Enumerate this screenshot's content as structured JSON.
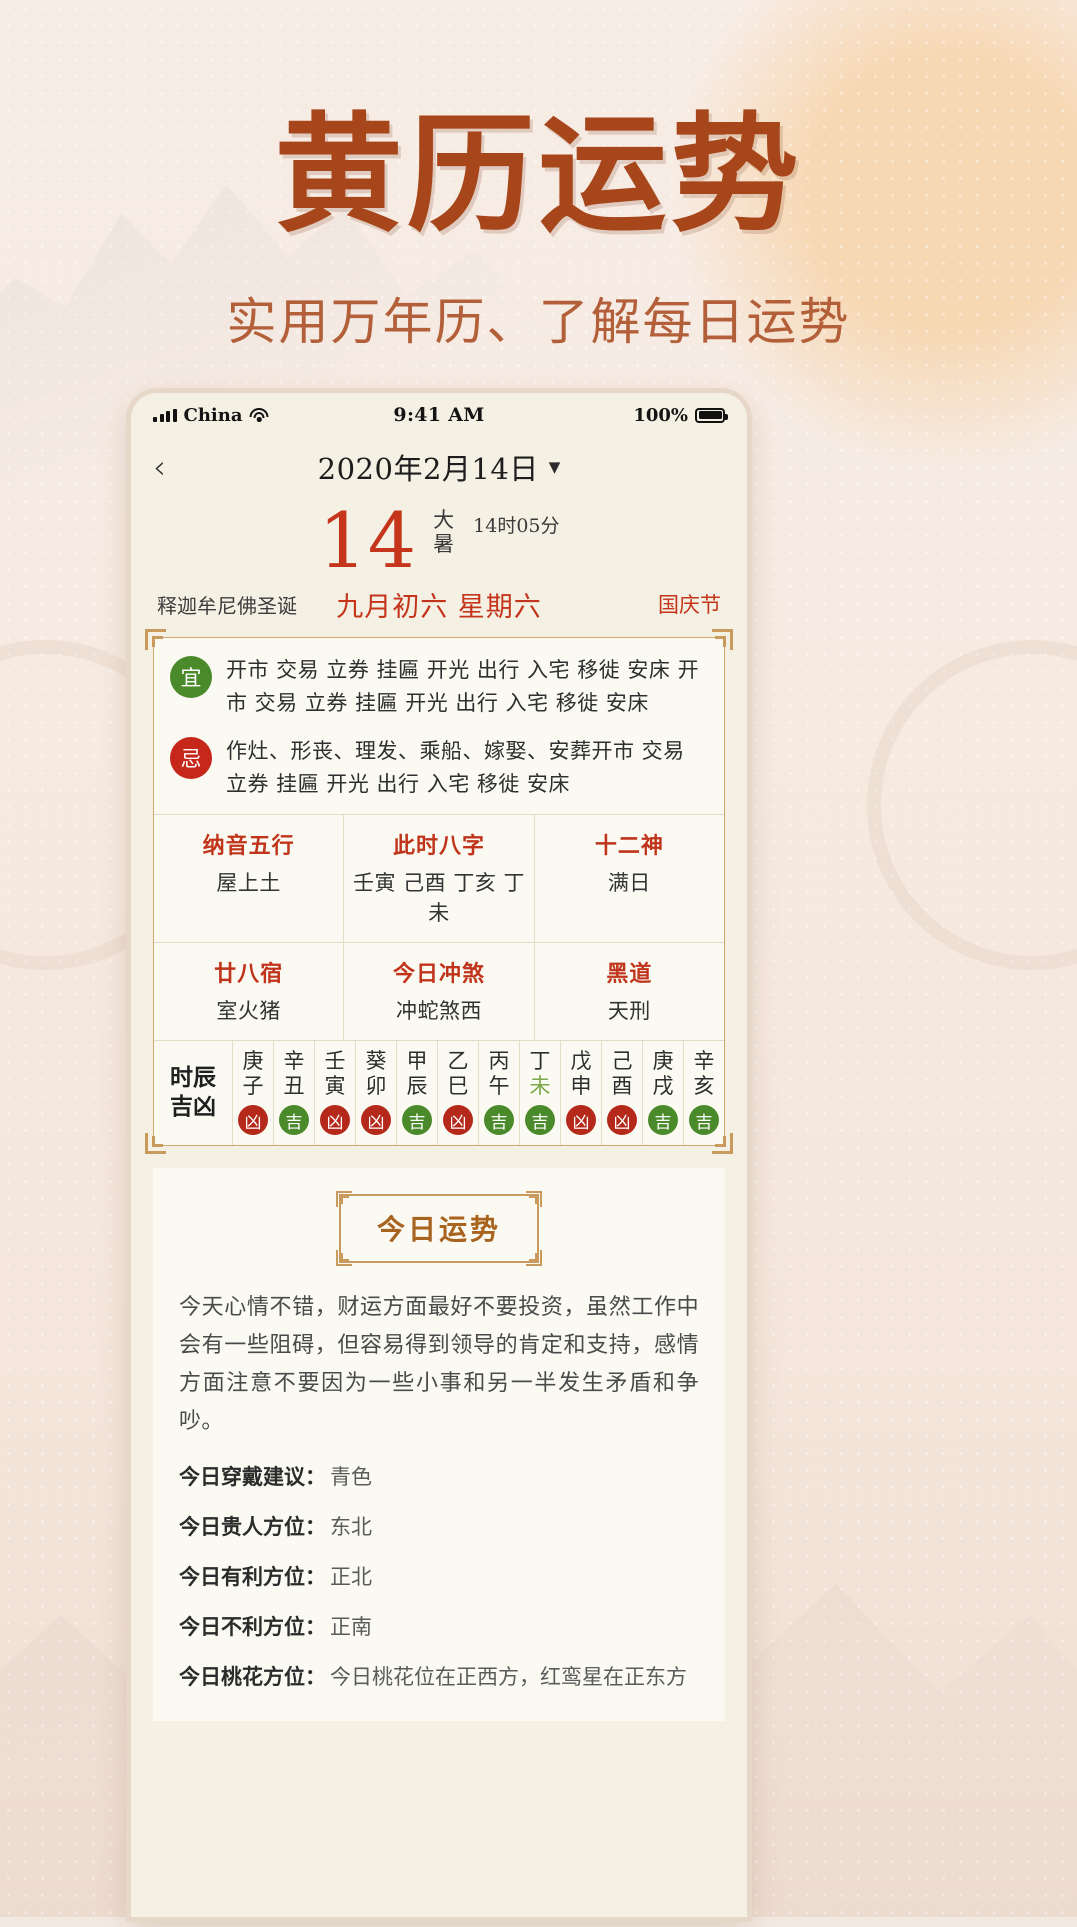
{
  "promo": {
    "title": "黄历运势",
    "subtitle": "实用万年历、了解每日运势",
    "title_color": "#a6461a",
    "subtitle_color": "#b3603a"
  },
  "status_bar": {
    "carrier": "China",
    "time": "9:41 AM",
    "battery_percent": "100%"
  },
  "nav": {
    "title": "2020年2月14日",
    "caret": "▼",
    "back": "‹"
  },
  "date": {
    "day_number": "14",
    "solar_term": "大暑",
    "solar_term_line1": "大",
    "solar_term_line2": "暑",
    "solar_term_time": "14时05分",
    "festival_left": "释迦牟尼佛圣诞",
    "lunar": "九月初六 星期六",
    "festival_right": "国庆节"
  },
  "almanac": {
    "yi": {
      "label": "宜",
      "items": "开市 交易 立券 挂匾 开光 出行 入宅 移徙 安床 开市 交易 立券 挂匾 开光 出行 入宅 移徙 安床",
      "color": "#4a8a2b"
    },
    "ji": {
      "label": "忌",
      "items": "作灶、形丧、理发、乘船、嫁娶、安葬开市 交易 立券 挂匾 开光 出行 入宅 移徙 安床",
      "color": "#c5271a"
    },
    "info_rows": [
      [
        {
          "title": "纳音五行",
          "value": "屋上土"
        },
        {
          "title": "此时八字",
          "value": "壬寅 己酉 丁亥 丁未"
        },
        {
          "title": "十二神",
          "value": "满日"
        }
      ],
      [
        {
          "title": "廿八宿",
          "value": "室火猪"
        },
        {
          "title": "今日冲煞",
          "value": "冲蛇煞西"
        },
        {
          "title": "黑道",
          "value": "天刑"
        }
      ]
    ],
    "shichen": {
      "label_line1": "时辰",
      "label_line2": "吉凶",
      "columns": [
        {
          "gan": "庚",
          "zhi": "子",
          "luck": "凶",
          "current": false
        },
        {
          "gan": "辛",
          "zhi": "丑",
          "luck": "吉",
          "current": false
        },
        {
          "gan": "壬",
          "zhi": "寅",
          "luck": "凶",
          "current": false
        },
        {
          "gan": "葵",
          "zhi": "卯",
          "luck": "凶",
          "current": false
        },
        {
          "gan": "甲",
          "zhi": "辰",
          "luck": "吉",
          "current": false
        },
        {
          "gan": "乙",
          "zhi": "巳",
          "luck": "凶",
          "current": false
        },
        {
          "gan": "丙",
          "zhi": "午",
          "luck": "吉",
          "current": false
        },
        {
          "gan": "丁",
          "zhi": "未",
          "luck": "吉",
          "current": true
        },
        {
          "gan": "戊",
          "zhi": "申",
          "luck": "凶",
          "current": false
        },
        {
          "gan": "己",
          "zhi": "酉",
          "luck": "凶",
          "current": false
        },
        {
          "gan": "庚",
          "zhi": "戌",
          "luck": "吉",
          "current": false
        },
        {
          "gan": "辛",
          "zhi": "亥",
          "luck": "吉",
          "current": false
        }
      ]
    }
  },
  "fortune": {
    "title": "今日运势",
    "text": "今天心情不错，财运方面最好不要投资，虽然工作中会有一些阻碍，但容易得到领导的肯定和支持，感情方面注意不要因为一些小事和另一半发生矛盾和争吵。",
    "advice": [
      {
        "label": "今日穿戴建议：",
        "value": "青色"
      },
      {
        "label": "今日贵人方位：",
        "value": "东北"
      },
      {
        "label": "今日有利方位：",
        "value": "正北"
      },
      {
        "label": "今日不利方位：",
        "value": "正南"
      },
      {
        "label": "今日桃花方位：",
        "value": "今日桃花位在正西方，红鸾星在正东方"
      }
    ]
  },
  "colors": {
    "accent_red": "#c5351b",
    "accent_brown": "#a6461a",
    "gold_border": "#c89a5d",
    "green": "#4a8a2b",
    "card_bg": "#fbfaf2"
  }
}
